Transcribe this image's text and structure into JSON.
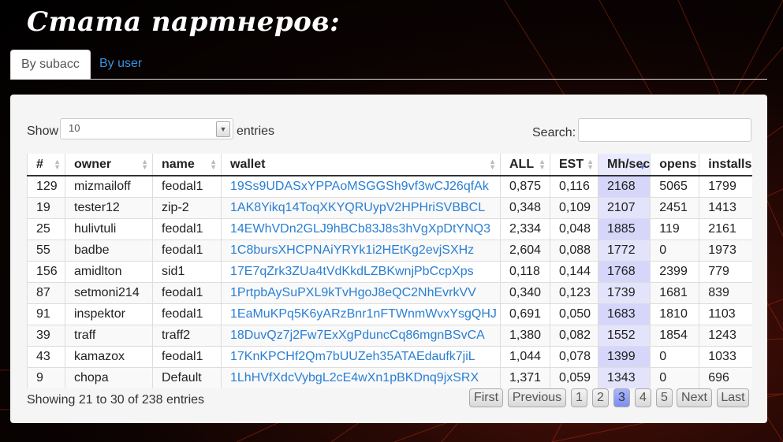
{
  "page": {
    "title": "Стата партнеров:"
  },
  "tabs": [
    {
      "label": "By subacc",
      "active": true
    },
    {
      "label": "By user",
      "active": false
    }
  ],
  "controls": {
    "show_label": "Show",
    "page_size": "10",
    "entries_label": "entries",
    "search_label": "Search:",
    "search_value": ""
  },
  "table": {
    "columns": [
      "#",
      "owner",
      "name",
      "wallet",
      "ALL",
      "EST",
      "Mh/sec",
      "opens",
      "installs"
    ],
    "sorted_column": "Mh/sec",
    "rows": [
      [
        "129",
        "mizmailoff",
        "feodal1",
        "19Ss9UDASxYPPAoMSGGSh9vf3wCJ26qfAk",
        "0,875",
        "0,116",
        "2168",
        "5065",
        "1799"
      ],
      [
        "19",
        "tester12",
        "zip-2",
        "1AK8Yikq14ToqXKYQRUypV2HPHriSVBBCL",
        "0,348",
        "0,109",
        "2107",
        "2451",
        "1413"
      ],
      [
        "25",
        "hulivtuli",
        "feodal1",
        "14EWhVDn2GLJ9hBCb83J8s3hVgXpDtYNQ3",
        "2,334",
        "0,048",
        "1885",
        "119",
        "2161"
      ],
      [
        "55",
        "badbe",
        "feodal1",
        "1C8bursXHCPNAiYRYk1i2HEtKg2evjSXHz",
        "2,604",
        "0,088",
        "1772",
        "0",
        "1973"
      ],
      [
        "156",
        "amidlton",
        "sid1",
        "17E7qZrk3ZUa4tVdKkdLZBKwnjPbCcpXps",
        "0,118",
        "0,144",
        "1768",
        "2399",
        "779"
      ],
      [
        "87",
        "setmoni214",
        "feodal1",
        "1PrtpbAySuPXL9kTvHgoJ8eQC2NhEvrkVV",
        "0,340",
        "0,123",
        "1739",
        "1681",
        "839"
      ],
      [
        "91",
        "inspektor",
        "feodal1",
        "1EaMuKPq5K6yARzBnr1nFTWnmWvxYsgQHJ",
        "0,691",
        "0,050",
        "1683",
        "1810",
        "1103"
      ],
      [
        "39",
        "traff",
        "traff2",
        "18DuvQz7j2Fw7ExXgPduncCq86mgnBSvCA",
        "1,380",
        "0,082",
        "1552",
        "1854",
        "1243"
      ],
      [
        "43",
        "kamazox",
        "feodal1",
        "17KnKPCHf2Qm7bUUZeh35ATAEdaufk7jiL",
        "1,044",
        "0,078",
        "1399",
        "0",
        "1033"
      ],
      [
        "9",
        "chopa",
        "Default",
        "1LhHVfXdcVybgL2cE4wXn1pBKDnq9jxSRX",
        "1,371",
        "0,059",
        "1343",
        "0",
        "696"
      ]
    ]
  },
  "footer": {
    "info": "Showing 21 to 30 of 238 entries",
    "pager": {
      "first": "First",
      "previous": "Previous",
      "pages": [
        "1",
        "2",
        "3",
        "4",
        "5"
      ],
      "current": "3",
      "next": "Next",
      "last": "Last"
    }
  },
  "colors": {
    "link": "#2a7fd4",
    "sorted_column": "#d6d6fb",
    "current_page": "#7c8ff0"
  }
}
